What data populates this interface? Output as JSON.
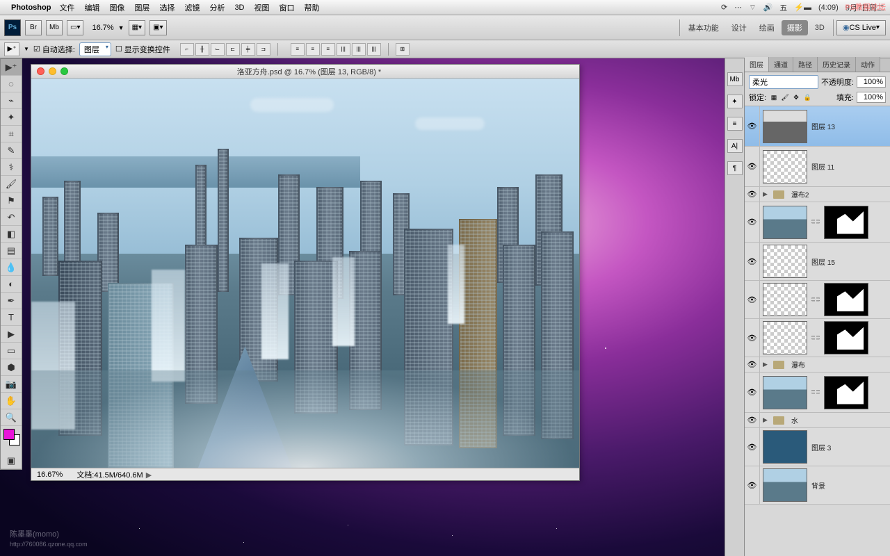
{
  "menubar": {
    "app": "Photoshop",
    "items": [
      "文件",
      "编辑",
      "图像",
      "图层",
      "选择",
      "滤镜",
      "分析",
      "3D",
      "视图",
      "窗口",
      "帮助"
    ],
    "right": {
      "ime": "五",
      "battery": "(4:09)",
      "date": "9月7日周二",
      "watermark": "PS教程论坛"
    }
  },
  "options_bar": {
    "br": "Br",
    "mb": "Mb",
    "zoom": "16.7%",
    "workspaces": [
      "基本功能",
      "设计",
      "绘画",
      "摄影",
      "3D"
    ],
    "active_ws": 3,
    "csLive": "CS Live"
  },
  "tool_options": {
    "auto_select": "自动选择:",
    "auto_select_value": "图层",
    "show_transform": "显示变换控件"
  },
  "document": {
    "title": "洛亚方舟.psd @ 16.7% (图层 13, RGB/8) *",
    "status_zoom": "16.67%",
    "status_doc": "文档:41.5M/640.6M"
  },
  "dock_icons": [
    "Mb",
    "✦",
    "≡",
    "A|",
    "¶"
  ],
  "layers_panel": {
    "tabs": [
      "图层",
      "通道",
      "路径",
      "历史记录",
      "动作"
    ],
    "active_tab": 0,
    "blend_mode": "柔光",
    "opacity_label": "不透明度:",
    "opacity": "100%",
    "lock_label": "锁定:",
    "fill_label": "填充:",
    "fill": "100%",
    "layers": [
      {
        "type": "layer",
        "name": "图层 13",
        "selected": true,
        "thumb": "gray-city",
        "tall": true
      },
      {
        "type": "layer",
        "name": "图层 11",
        "thumb": "checker",
        "tall": true
      },
      {
        "type": "group",
        "name": "瀑布2"
      },
      {
        "type": "masked",
        "thumb": "city",
        "mask": true,
        "tall": true
      },
      {
        "type": "layer",
        "name": "图层 15",
        "thumb": "checker"
      },
      {
        "type": "masked",
        "thumb": "checker",
        "mask": true,
        "mask_style": "white"
      },
      {
        "type": "masked",
        "thumb": "checker",
        "mask": true,
        "mask_style": "splash"
      },
      {
        "type": "group",
        "name": "瀑布"
      },
      {
        "type": "masked",
        "thumb": "city",
        "mask": true,
        "tall": true
      },
      {
        "type": "group",
        "name": "水"
      },
      {
        "type": "layer",
        "name": "图层 3",
        "thumb": "solid-blue"
      },
      {
        "type": "layer",
        "name": "背景",
        "thumb": "city"
      }
    ]
  },
  "watermark": {
    "name": "陈墨墨(momo)",
    "url": "http://760086.qzone.qq.com"
  }
}
